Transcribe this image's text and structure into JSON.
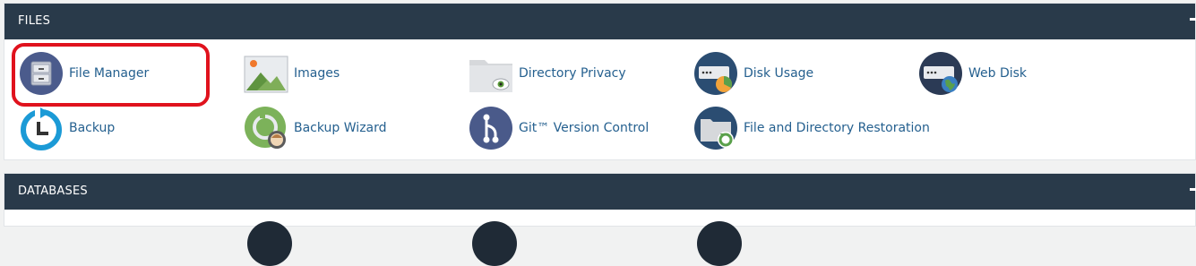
{
  "files_section": {
    "title": "FILES",
    "items": [
      {
        "label": "File Manager",
        "icon": "file-manager-icon"
      },
      {
        "label": "Images",
        "icon": "images-icon"
      },
      {
        "label": "Directory Privacy",
        "icon": "directory-privacy-icon"
      },
      {
        "label": "Disk Usage",
        "icon": "disk-usage-icon"
      },
      {
        "label": "Web Disk",
        "icon": "web-disk-icon"
      },
      {
        "label": "Backup",
        "icon": "backup-icon"
      },
      {
        "label": "Backup Wizard",
        "icon": "backup-wizard-icon"
      },
      {
        "label": "Git™ Version Control",
        "icon": "git-icon"
      },
      {
        "label": "File and Directory Restoration",
        "icon": "file-restoration-icon"
      }
    ]
  },
  "databases_section": {
    "title": "DATABASES"
  },
  "colors": {
    "header_bg": "#293a4a",
    "link": "#25608f",
    "highlight": "#e0121d",
    "icon_navy": "#4a5a8a"
  }
}
